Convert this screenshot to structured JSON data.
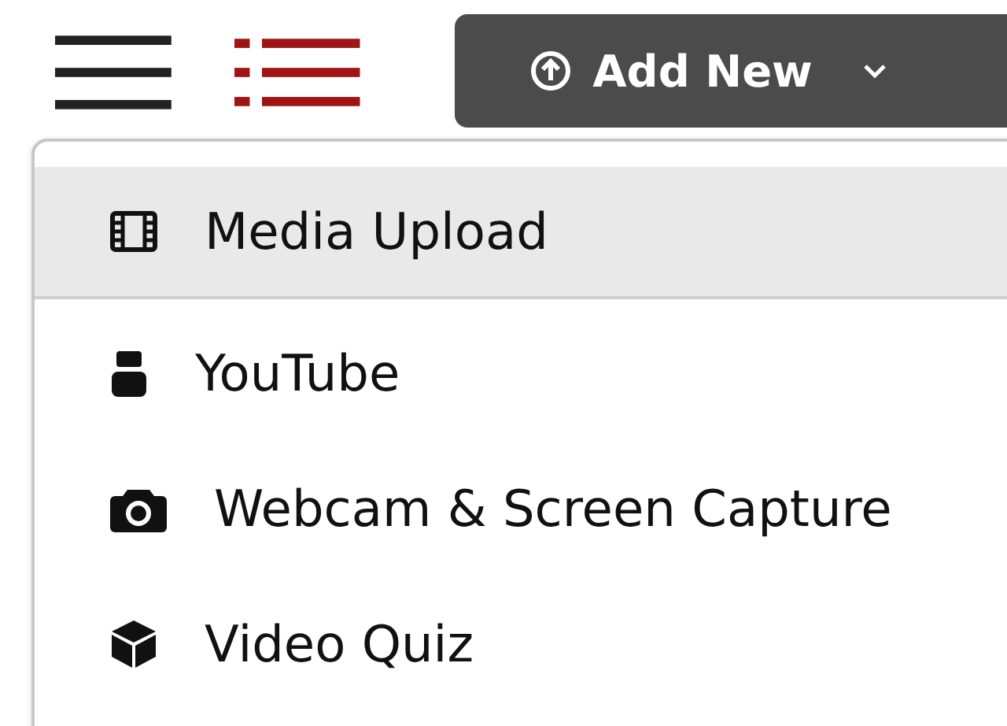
{
  "toolbar": {
    "add_button": {
      "label": "Add New"
    }
  },
  "menu": {
    "items": [
      {
        "kind": "film",
        "label": "Media Upload",
        "selected": true
      },
      {
        "kind": "youtube",
        "label": "YouTube",
        "selected": false
      },
      {
        "kind": "camera",
        "label": "Webcam & Screen Capture",
        "selected": false
      },
      {
        "kind": "cube",
        "label": "Video Quiz",
        "selected": false
      }
    ]
  }
}
